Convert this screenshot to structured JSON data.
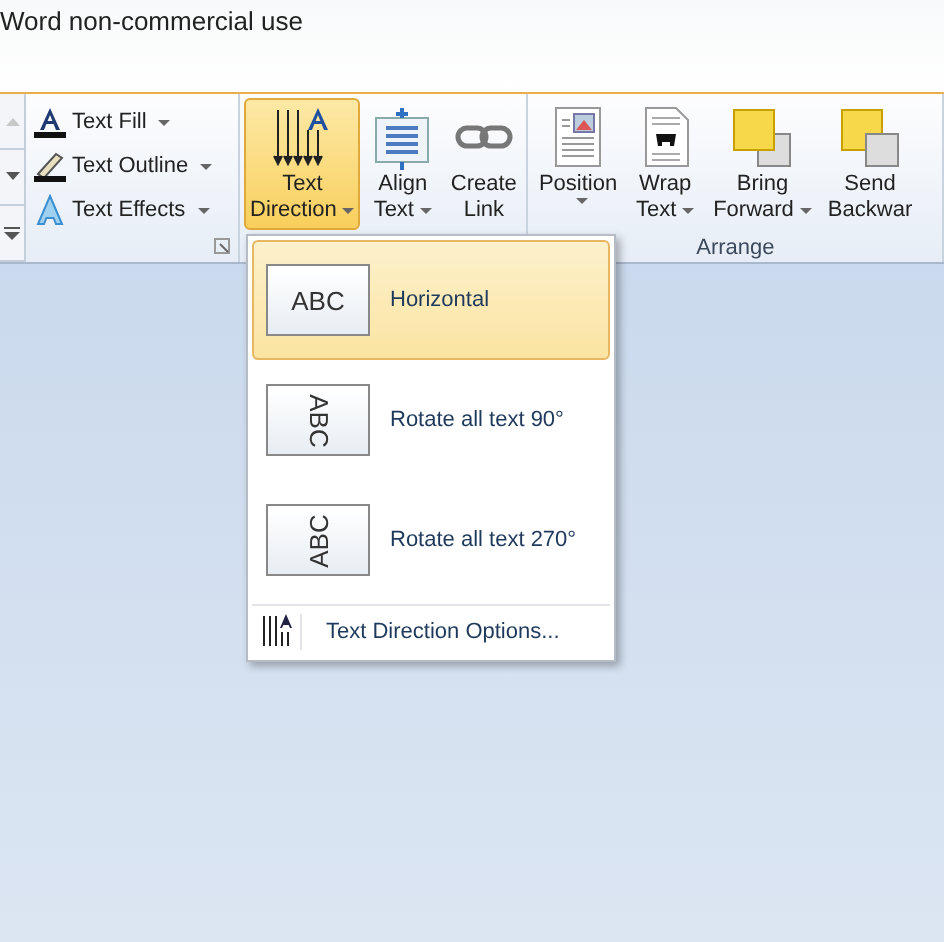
{
  "title_bar": {
    "title": "Word non-commercial use"
  },
  "wordart_styles": [
    {
      "label": "Text Fill",
      "kind": "fill"
    },
    {
      "label": "Text Outline",
      "kind": "outline"
    },
    {
      "label": "Text Effects",
      "kind": "effects"
    }
  ],
  "groups": [
    {
      "buttons": [
        {
          "lines": [
            "Text",
            "Direction"
          ],
          "kind": "direction",
          "dropdown": true,
          "selected": true
        },
        {
          "lines": [
            "Align",
            "Text"
          ],
          "kind": "align",
          "dropdown": true,
          "selected": false
        },
        {
          "lines": [
            "Create",
            "Link"
          ],
          "kind": "link",
          "dropdown": false,
          "selected": false
        }
      ]
    },
    {
      "label": "Arrange",
      "buttons": [
        {
          "lines": [
            "Position"
          ],
          "kind": "position",
          "dropdown": true,
          "selected": false
        },
        {
          "lines": [
            "Wrap",
            "Text"
          ],
          "kind": "wrap",
          "dropdown": true,
          "selected": false
        },
        {
          "lines": [
            "Bring",
            "Forward"
          ],
          "kind": "forward",
          "dropdown": true,
          "selected": false
        },
        {
          "lines": [
            "Send",
            "Backwar"
          ],
          "kind": "backward",
          "dropdown": false,
          "selected": false
        }
      ]
    }
  ],
  "menu": {
    "items": [
      {
        "label": "Horizontal",
        "preview": "ABC",
        "kind": "horizontal",
        "selected": true
      },
      {
        "label": "Rotate all text 90°",
        "preview": "ABC",
        "kind": "rotate90",
        "selected": false
      },
      {
        "label": "Rotate all text 270°",
        "preview": "ABC",
        "kind": "rotate270",
        "selected": false
      }
    ],
    "footer": "Text Direction Options..."
  }
}
